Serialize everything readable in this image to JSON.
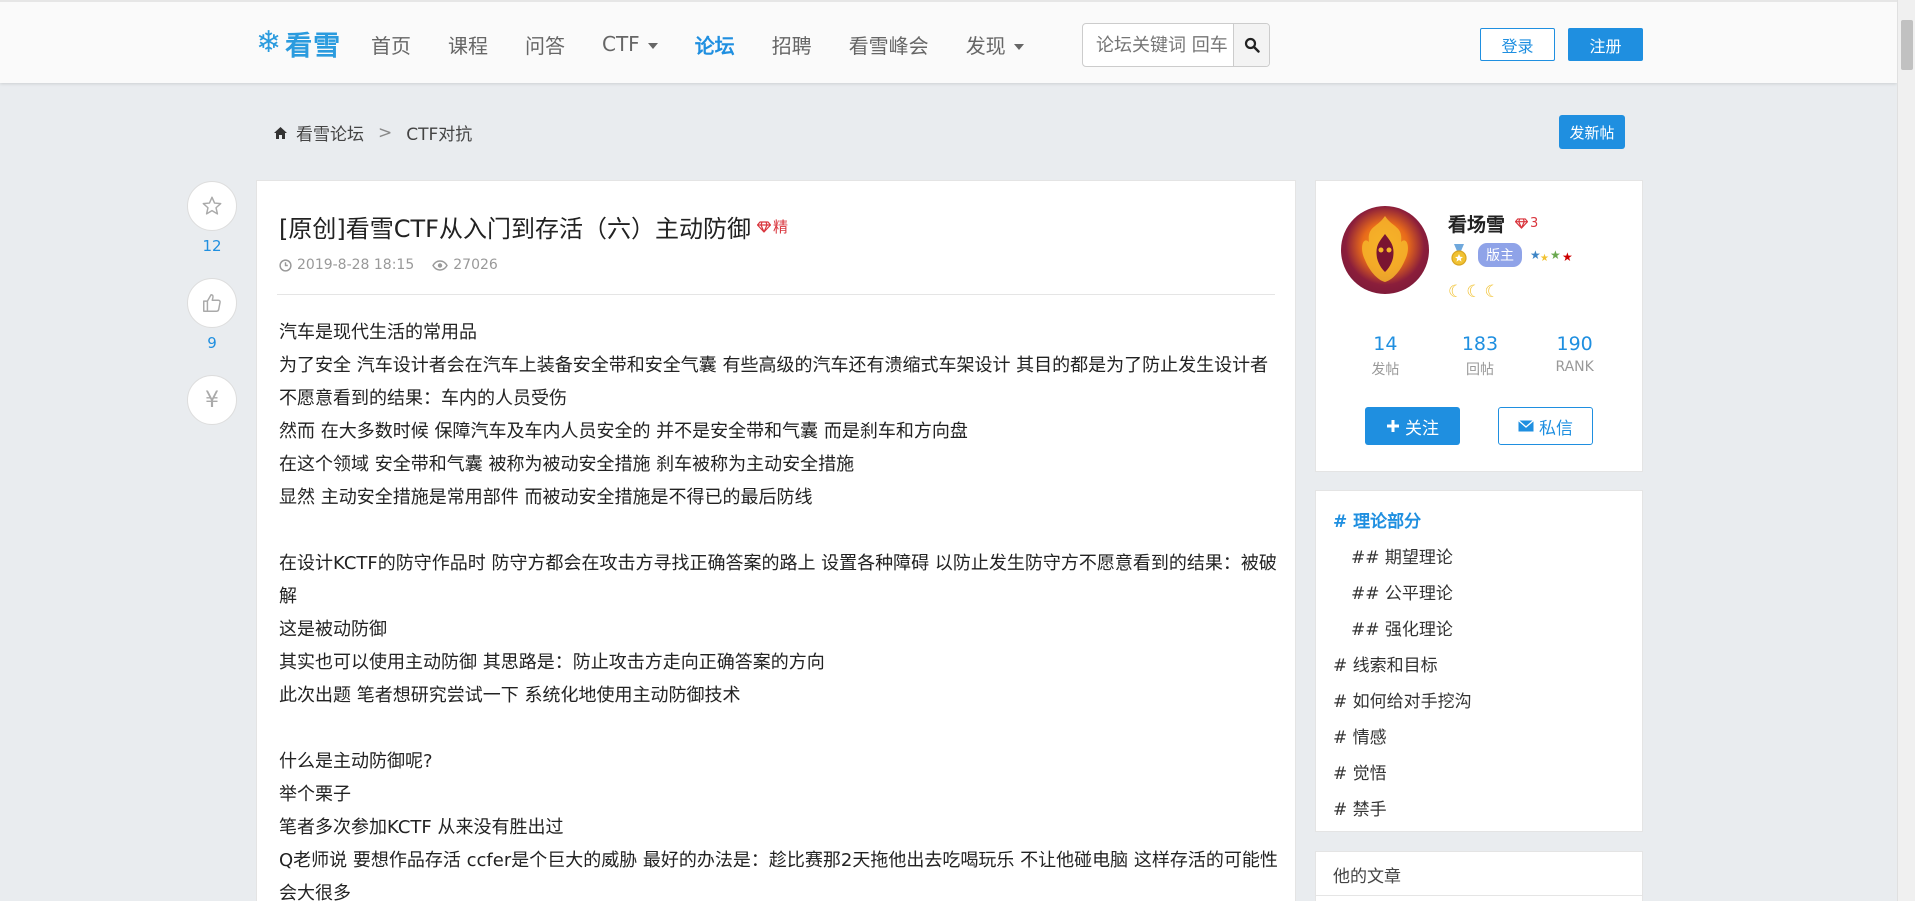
{
  "header": {
    "logo_text": "看雪",
    "nav": [
      {
        "label": "首页",
        "active": false,
        "dropdown": false
      },
      {
        "label": "课程",
        "active": false,
        "dropdown": false
      },
      {
        "label": "问答",
        "active": false,
        "dropdown": false
      },
      {
        "label": "CTF",
        "active": false,
        "dropdown": true
      },
      {
        "label": "论坛",
        "active": true,
        "dropdown": false
      },
      {
        "label": "招聘",
        "active": false,
        "dropdown": false
      },
      {
        "label": "看雪峰会",
        "active": false,
        "dropdown": false
      },
      {
        "label": "发现",
        "active": false,
        "dropdown": true
      }
    ],
    "search_placeholder": "论坛关键词 回车",
    "login_label": "登录",
    "register_label": "注册"
  },
  "breadcrumb": {
    "home": "看雪论坛",
    "separator": ">",
    "current": "CTF对抗"
  },
  "new_post_label": "发新帖",
  "actions": {
    "favorite_count": "12",
    "like_count": "9",
    "reward_symbol": "¥"
  },
  "article": {
    "title": "[原创]看雪CTF从入门到存活（六）主动防御",
    "badge": "精",
    "date": "2019-8-28 18:15",
    "views": "27026",
    "paragraphs": [
      "汽车是现代生活的常用品",
      "为了安全 汽车设计者会在汽车上装备安全带和安全气囊 有些高级的汽车还有溃缩式车架设计 其目的都是为了防止发生设计者不愿意看到的结果：车内的人员受伤",
      "然而 在大多数时候 保障汽车及车内人员安全的 并不是安全带和气囊 而是刹车和方向盘",
      "在这个领域 安全带和气囊 被称为被动安全措施 刹车被称为主动安全措施",
      "显然 主动安全措施是常用部件 而被动安全措施是不得已的最后防线",
      "",
      "在设计KCTF的防守作品时 防守方都会在攻击方寻找正确答案的路上 设置各种障碍 以防止发生防守方不愿意看到的结果：被破解",
      "这是被动防御",
      "其实也可以使用主动防御 其思路是：防止攻击方走向正确答案的方向",
      "此次出题 笔者想研究尝试一下 系统化地使用主动防御技术",
      "",
      "什么是主动防御呢?",
      "举个栗子",
      "笔者多次参加KCTF 从来没有胜出过",
      "Q老师说 要想作品存活 ccfer是个巨大的威胁 最好的办法是：趁比赛那2天拖他出去吃喝玩乐 不让他碰电脑 这样存活的可能性会大很多"
    ]
  },
  "profile": {
    "name": "看场雪",
    "level": "3",
    "role": "版主",
    "stats": [
      {
        "num": "14",
        "label": "发帖"
      },
      {
        "num": "183",
        "label": "回帖"
      },
      {
        "num": "190",
        "label": "RANK"
      }
    ],
    "follow_label": "关注",
    "message_label": "私信"
  },
  "toc": [
    {
      "label": "# 理论部分",
      "sub": false,
      "active": true
    },
    {
      "label": "## 期望理论",
      "sub": true,
      "active": false
    },
    {
      "label": "## 公平理论",
      "sub": true,
      "active": false
    },
    {
      "label": "## 强化理论",
      "sub": true,
      "active": false
    },
    {
      "label": "# 线索和目标",
      "sub": false,
      "active": false
    },
    {
      "label": "# 如何给对手挖沟",
      "sub": false,
      "active": false
    },
    {
      "label": "# 情感",
      "sub": false,
      "active": false
    },
    {
      "label": "# 觉悟",
      "sub": false,
      "active": false
    },
    {
      "label": "# 禁手",
      "sub": false,
      "active": false
    }
  ],
  "others_title": "他的文章",
  "colors": {
    "accent": "#1f8fe0",
    "badge_red": "#d9363e",
    "page_bg": "#e9ecef"
  }
}
